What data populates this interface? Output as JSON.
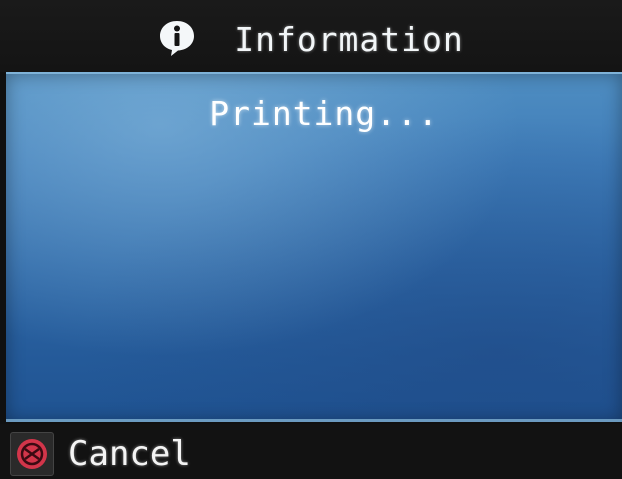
{
  "header": {
    "title": "Information",
    "icon": "info-icon"
  },
  "panel": {
    "status": "Printing..."
  },
  "footer": {
    "cancel_label": "Cancel",
    "cancel_icon": "stop-icon",
    "cancel_icon_color": "#d2354a"
  },
  "colors": {
    "panel_blue": "#3f7cb8",
    "header_bg": "#141414"
  }
}
